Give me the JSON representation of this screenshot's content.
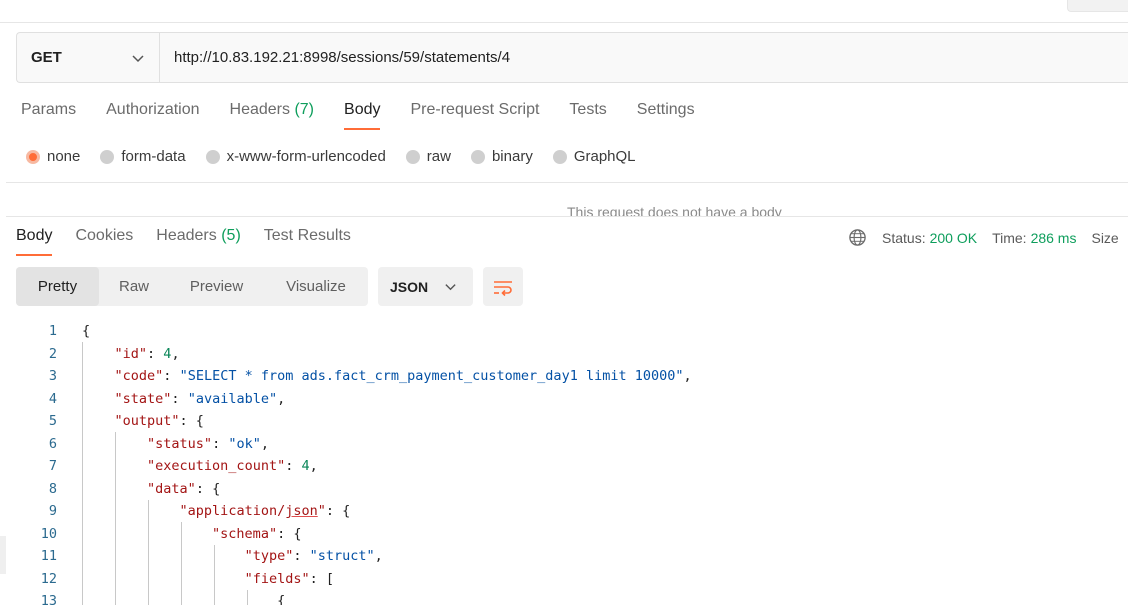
{
  "request": {
    "method": "GET",
    "url": "http://10.83.192.21:8998/sessions/59/statements/4",
    "tabs": [
      {
        "label": "Params",
        "count": ""
      },
      {
        "label": "Authorization",
        "count": ""
      },
      {
        "label": "Headers",
        "count": "(7)"
      },
      {
        "label": "Body",
        "count": ""
      },
      {
        "label": "Pre-request Script",
        "count": ""
      },
      {
        "label": "Tests",
        "count": ""
      },
      {
        "label": "Settings",
        "count": ""
      }
    ],
    "active_tab": "Body",
    "body_types": [
      "none",
      "form-data",
      "x-www-form-urlencoded",
      "raw",
      "binary",
      "GraphQL"
    ],
    "selected_body_type": "none",
    "no_body_message": "This request does not have a body"
  },
  "response": {
    "tabs": [
      {
        "label": "Body",
        "count": ""
      },
      {
        "label": "Cookies",
        "count": ""
      },
      {
        "label": "Headers",
        "count": "(5)"
      },
      {
        "label": "Test Results",
        "count": ""
      }
    ],
    "status_label": "Status:",
    "status_value": "200 OK",
    "time_label": "Time:",
    "time_value": "286 ms",
    "size_label": "Size",
    "view_modes": [
      "Pretty",
      "Raw",
      "Preview",
      "Visualize"
    ],
    "active_view": "Pretty",
    "format": "JSON"
  },
  "icons": {
    "method_dropdown": "chevron-down-icon",
    "format_dropdown": "chevron-down-icon",
    "wrap": "wrap-lines-icon",
    "globe": "globe-icon"
  },
  "colors": {
    "accent": "#ff6c37",
    "success": "#0e9e5c"
  },
  "code_lines": [
    {
      "n": "1",
      "t": "{"
    },
    {
      "n": "2",
      "t": "    \"id\": 4,"
    },
    {
      "n": "3",
      "t": "    \"code\": \"SELECT * from ads.fact_crm_payment_customer_day1 limit 10000\","
    },
    {
      "n": "4",
      "t": "    \"state\": \"available\","
    },
    {
      "n": "5",
      "t": "    \"output\": {"
    },
    {
      "n": "6",
      "t": "        \"status\": \"ok\","
    },
    {
      "n": "7",
      "t": "        \"execution_count\": 4,"
    },
    {
      "n": "8",
      "t": "        \"data\": {"
    },
    {
      "n": "9",
      "t": "            \"application/json\": {"
    },
    {
      "n": "10",
      "t": "                \"schema\": {"
    },
    {
      "n": "11",
      "t": "                    \"type\": \"struct\","
    },
    {
      "n": "12",
      "t": "                    \"fields\": ["
    },
    {
      "n": "13",
      "t": "                        {"
    }
  ]
}
